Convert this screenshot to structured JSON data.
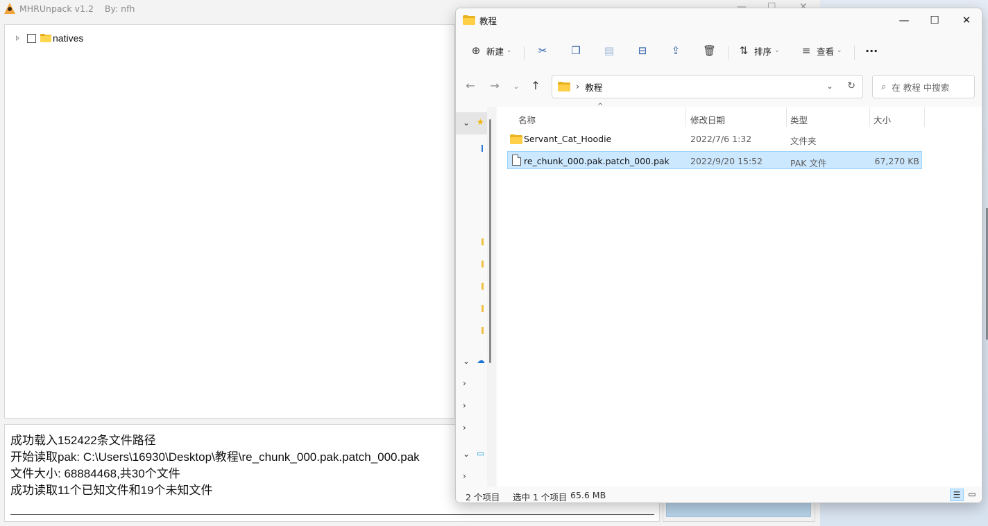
{
  "app": {
    "title": "MHRUnpack v1.2",
    "author": "By: nfh",
    "controls": {
      "min": "—",
      "max": "☐",
      "close": "✕"
    },
    "tree": {
      "root_label": "natives"
    },
    "log": [
      "成功载入152422条文件路径",
      "开始读取pak: C:\\Users\\16930\\Desktop\\教程\\re_chunk_000.pak.patch_000.pak",
      "文件大小: 68884468,共30个文件",
      "成功读取11个已知文件和19个未知文件"
    ]
  },
  "explorer": {
    "title": "教程",
    "controls": {
      "min": "—",
      "max": "☐",
      "close": "✕"
    },
    "toolbar": {
      "new_label": "新建",
      "sort_label": "排序",
      "view_label": "查看",
      "more_label": "···"
    },
    "address": {
      "path": "教程",
      "separator": "›"
    },
    "search": {
      "placeholder": "在 教程 中搜索"
    },
    "columns": {
      "name": "名称",
      "date": "修改日期",
      "type": "类型",
      "size": "大小"
    },
    "files": [
      {
        "name": "Servant_Cat_Hoodie",
        "date": "2022/7/6 1:32",
        "type": "文件夹",
        "size": "",
        "kind": "folder",
        "selected": false
      },
      {
        "name": "re_chunk_000.pak.patch_000.pak",
        "date": "2022/9/20 15:52",
        "type": "PAK 文件",
        "size": "67,270 KB",
        "kind": "file",
        "selected": true
      }
    ],
    "status": {
      "count": "2 个项目",
      "selection": "选中 1 个项目",
      "size": "65.6 MB"
    }
  },
  "colors": {
    "accent": "#0067c0",
    "selection": "#cce8ff",
    "folder": "#ffcf48"
  }
}
